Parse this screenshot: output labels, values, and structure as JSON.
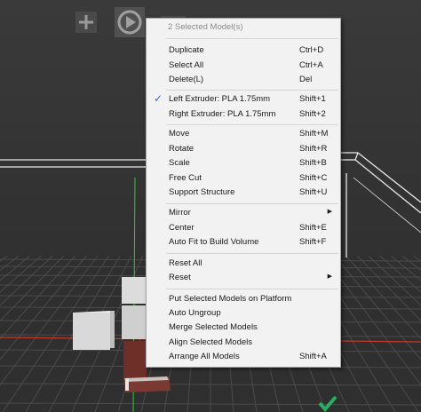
{
  "toolbar": {
    "add_icon": "plus-icon",
    "play_icon": "play-icon",
    "view_icon": "view-icon"
  },
  "context_menu": {
    "header": "2 Selected Model(s)",
    "groups": [
      {
        "items": [
          {
            "label": "Duplicate",
            "shortcut": "Ctrl+D"
          },
          {
            "label": "Select All",
            "shortcut": "Ctrl+A"
          },
          {
            "label": "Delete(L)",
            "shortcut": "Del"
          }
        ]
      },
      {
        "items": [
          {
            "label": "Left Extruder: PLA 1.75mm",
            "shortcut": "Shift+1",
            "checked": true
          },
          {
            "label": "Right Extruder: PLA 1.75mm",
            "shortcut": "Shift+2"
          }
        ]
      },
      {
        "items": [
          {
            "label": "Move",
            "shortcut": "Shift+M"
          },
          {
            "label": "Rotate",
            "shortcut": "Shift+R"
          },
          {
            "label": "Scale",
            "shortcut": "Shift+B"
          },
          {
            "label": "Free Cut",
            "shortcut": "Shift+C"
          },
          {
            "label": "Support Structure",
            "shortcut": "Shift+U"
          }
        ]
      },
      {
        "items": [
          {
            "label": "Mirror",
            "shortcut": "",
            "submenu": true
          },
          {
            "label": "Center",
            "shortcut": "Shift+E"
          },
          {
            "label": "Auto Fit to Build Volume",
            "shortcut": "Shift+F"
          }
        ]
      },
      {
        "items": [
          {
            "label": "Reset All",
            "shortcut": ""
          },
          {
            "label": "Reset",
            "shortcut": "",
            "submenu": true
          }
        ]
      },
      {
        "items": [
          {
            "label": "Put Selected Models on Platform",
            "shortcut": ""
          },
          {
            "label": "Auto Ungroup",
            "shortcut": ""
          },
          {
            "label": "Merge Selected Models",
            "shortcut": ""
          },
          {
            "label": "Align Selected Models",
            "shortcut": ""
          },
          {
            "label": "Arrange All Models",
            "shortcut": "Shift+A"
          }
        ]
      }
    ]
  },
  "colors": {
    "menu_bg": "#f2f2f2",
    "check_mark": "#2a6bd1",
    "x_axis": "#c0392b",
    "y_axis": "#2ecc40",
    "selected_model": "#6e2f28",
    "confirm": "#27ae60"
  }
}
